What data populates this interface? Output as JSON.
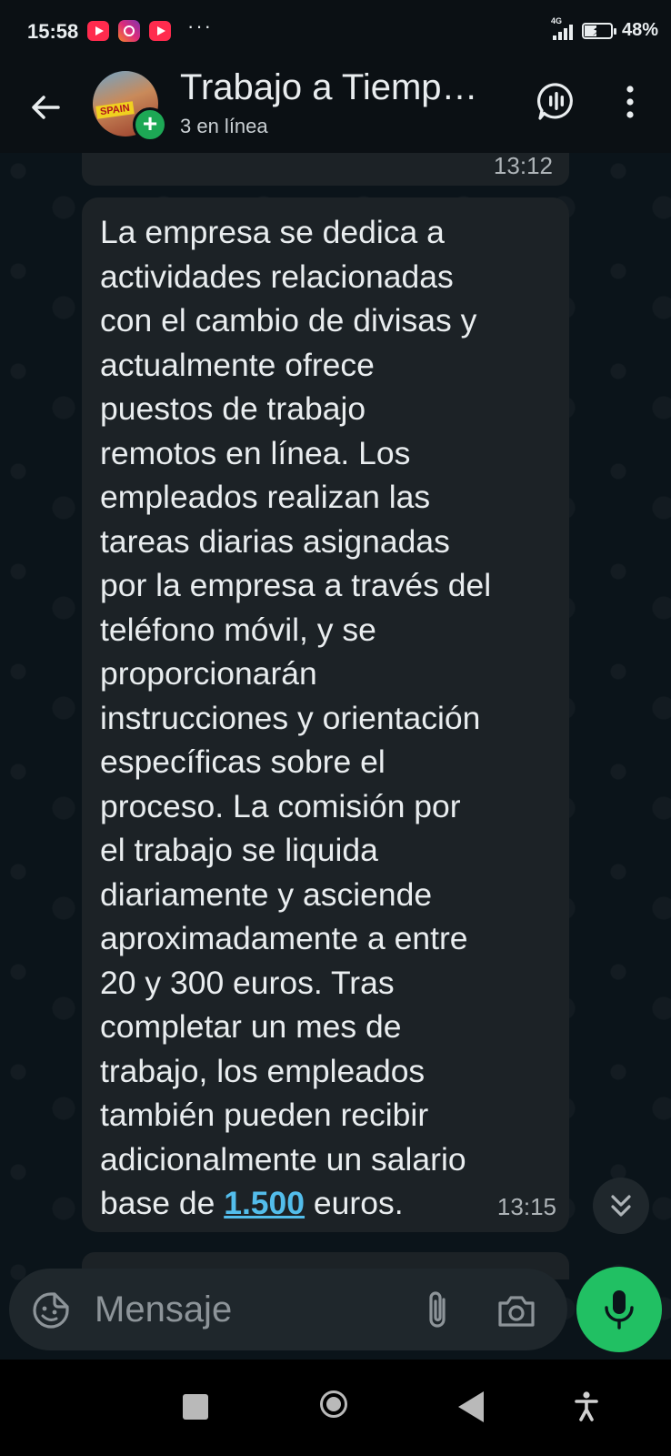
{
  "status_bar": {
    "time": "15:58",
    "network": "4G",
    "battery_percent": "48%",
    "battery_level": 0.48,
    "notification_icons": [
      "youtube-icon",
      "instagram-icon",
      "youtube-icon"
    ],
    "overflow_indicator": "···"
  },
  "header": {
    "chat_title": "Trabajo a Tiemp…",
    "chat_subtitle": "3 en línea",
    "avatar_text": "SPAIN",
    "icons": {
      "back": "arrow-left-icon",
      "call": "voice-chat-icon",
      "menu": "more-vert-icon"
    }
  },
  "messages": {
    "previous_time": "13:12",
    "main": {
      "text_before_link": "La empresa se dedica a\nactividades relacionadas\ncon el cambio de divisas y\nactualmente ofrece\npuestos de trabajo\nremotos en línea. Los\nempleados realizan las\ntareas diarias asignadas\npor la empresa a través del\nteléfono móvil, y se\nproporcionarán\ninstrucciones y orientación\nespecíficas sobre el\nproceso. La comisión por\nel trabajo se liquida\ndiariamente y asciende\naproximadamente a entre\n20 y 300 euros. Tras\ncompletar un mes de\ntrabajo, los empleados\ntambién pueden recibir\nadicionalmente un salario\nbase de ",
      "link_text": "1.500",
      "text_after_link": " euros.",
      "time": "13:15"
    }
  },
  "input_bar": {
    "placeholder": "Mensaje",
    "value": ""
  },
  "colors": {
    "app_bar": "#0b1014",
    "chat_background": "#0b141a",
    "bubble": "#1c2226",
    "link": "#53bdeb",
    "accent_green": "#21c063"
  }
}
